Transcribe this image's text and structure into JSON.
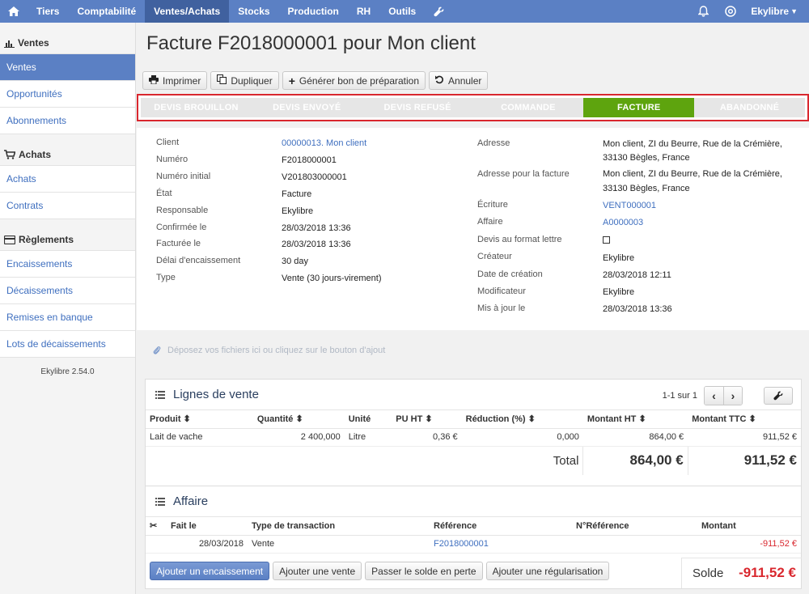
{
  "topnav": {
    "items": [
      "Tiers",
      "Comptabilité",
      "Ventes/Achats",
      "Stocks",
      "Production",
      "RH",
      "Outils"
    ],
    "user": "Ekylibre"
  },
  "sidebar": {
    "sections": [
      {
        "title": "Ventes",
        "items": [
          "Ventes",
          "Opportunités",
          "Abonnements"
        ]
      },
      {
        "title": "Achats",
        "items": [
          "Achats",
          "Contrats"
        ]
      },
      {
        "title": "Règlements",
        "items": [
          "Encaissements",
          "Décaissements",
          "Remises en banque",
          "Lots de décaissements"
        ]
      }
    ],
    "version": "Ekylibre 2.54.0"
  },
  "page": {
    "title": "Facture F2018000001 pour Mon client"
  },
  "toolbar": {
    "print": "Imprimer",
    "duplicate": "Dupliquer",
    "generate": "Générer bon de préparation",
    "cancel": "Annuler"
  },
  "steps": [
    "DEVIS BROUILLON",
    "DEVIS ENVOYÉ",
    "DEVIS REFUSÉ",
    "COMMANDE",
    "FACTURE",
    "ABANDONNÉ"
  ],
  "details_left": [
    {
      "label": "Client",
      "value": "00000013. Mon client",
      "link": true
    },
    {
      "label": "Numéro",
      "value": "F2018000001"
    },
    {
      "label": "Numéro initial",
      "value": "V201803000001"
    },
    {
      "label": "État",
      "value": "Facture"
    },
    {
      "label": "Responsable",
      "value": "Ekylibre"
    },
    {
      "label": "Confirmée le",
      "value": "28/03/2018 13:36"
    },
    {
      "label": "Facturée le",
      "value": "28/03/2018 13:36"
    },
    {
      "label": "Délai d'encaissement",
      "value": "30 day"
    },
    {
      "label": "Type",
      "value": "Vente (30 jours-virement)"
    }
  ],
  "details_right": {
    "adresse_label": "Adresse",
    "adresse_l1": "Mon client, ZI du Beurre, Rue de la Crémière,",
    "adresse_l2": "33130 Bègles, France",
    "adresse_fact_label": "Adresse pour la facture",
    "adresse_fact_l1": "Mon client, ZI du Beurre, Rue de la Crémière,",
    "adresse_fact_l2": "33130 Bègles, France",
    "ecriture_label": "Écriture",
    "ecriture": "VENT000001",
    "affaire_label": "Affaire",
    "affaire": "A0000003",
    "devis_label": "Devis au format lettre",
    "createur_label": "Créateur",
    "createur": "Ekylibre",
    "date_creation_label": "Date de création",
    "date_creation": "28/03/2018 12:11",
    "modificateur_label": "Modificateur",
    "modificateur": "Ekylibre",
    "maj_label": "Mis à jour le",
    "maj": "28/03/2018 13:36"
  },
  "dropzone": "Déposez vos fichiers ici ou cliquez sur le bouton d'ajout",
  "lignes": {
    "title": "Lignes de vente",
    "pager": "1-1 sur 1",
    "headers": {
      "produit": "Produit",
      "quantite": "Quantité",
      "unite": "Unité",
      "pu": "PU HT",
      "reduction": "Réduction (%)",
      "montant_ht": "Montant HT",
      "montant_ttc": "Montant TTC"
    },
    "row": {
      "produit": "Lait de vache",
      "quantite": "2 400,000",
      "unite": "Litre",
      "pu": "0,36 €",
      "reduction": "0,000",
      "montant_ht": "864,00 €",
      "montant_ttc": "911,52 €"
    },
    "total_label": "Total",
    "total_ht": "864,00 €",
    "total_ttc": "911,52 €"
  },
  "affaire": {
    "title": "Affaire",
    "headers": {
      "fait_le": "Fait le",
      "type": "Type de transaction",
      "reference": "Référence",
      "n_reference": "N°Référence",
      "montant": "Montant"
    },
    "row": {
      "fait_le": "28/03/2018",
      "type": "Vente",
      "reference": "F2018000001",
      "montant": "-911,52 €"
    },
    "buttons": {
      "encaissement": "Ajouter un encaissement",
      "vente": "Ajouter une vente",
      "solde": "Passer le solde en perte",
      "regularisation": "Ajouter une régularisation"
    },
    "solde_label": "Solde",
    "solde": "-911,52 €"
  }
}
